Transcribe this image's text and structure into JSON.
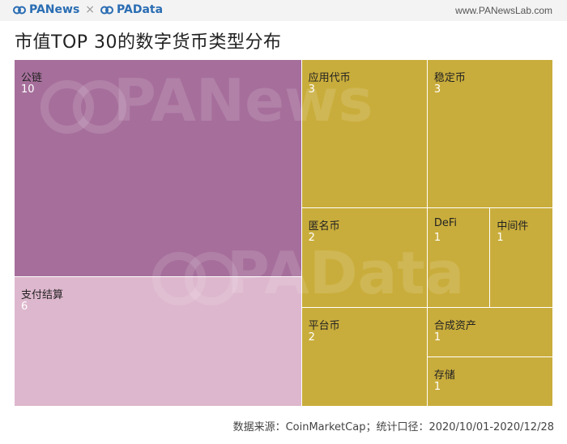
{
  "header": {
    "brand_left": "PANews",
    "brand_sep": "×",
    "brand_right": "PAData",
    "site": "www.PANewsLab.com"
  },
  "watermarks": {
    "top": "PANews",
    "bottom": "PAData"
  },
  "colors": {
    "public_chain": "#a66f9b",
    "payment": "#ddb7cd",
    "gold": "#c9ad3c"
  },
  "chart_data": {
    "type": "treemap",
    "title": "市值TOP 30的数字货币类型分布",
    "items": [
      {
        "name": "公链",
        "value": 10,
        "color": "#a66f9b"
      },
      {
        "name": "支付结算",
        "value": 6,
        "color": "#ddb7cd"
      },
      {
        "name": "应用代币",
        "value": 3,
        "color": "#c9ad3c"
      },
      {
        "name": "稳定币",
        "value": 3,
        "color": "#c9ad3c"
      },
      {
        "name": "匿名币",
        "value": 2,
        "color": "#c9ad3c"
      },
      {
        "name": "DeFi",
        "value": 1,
        "color": "#c9ad3c"
      },
      {
        "name": "中间件",
        "value": 1,
        "color": "#c9ad3c"
      },
      {
        "name": "平台币",
        "value": 2,
        "color": "#c9ad3c"
      },
      {
        "name": "合成资产",
        "value": 1,
        "color": "#c9ad3c"
      },
      {
        "name": "存储",
        "value": 1,
        "color": "#c9ad3c"
      }
    ]
  },
  "footer": {
    "source": "数据来源：CoinMarketCap；统计口径：2020/10/01-2020/12/28"
  }
}
